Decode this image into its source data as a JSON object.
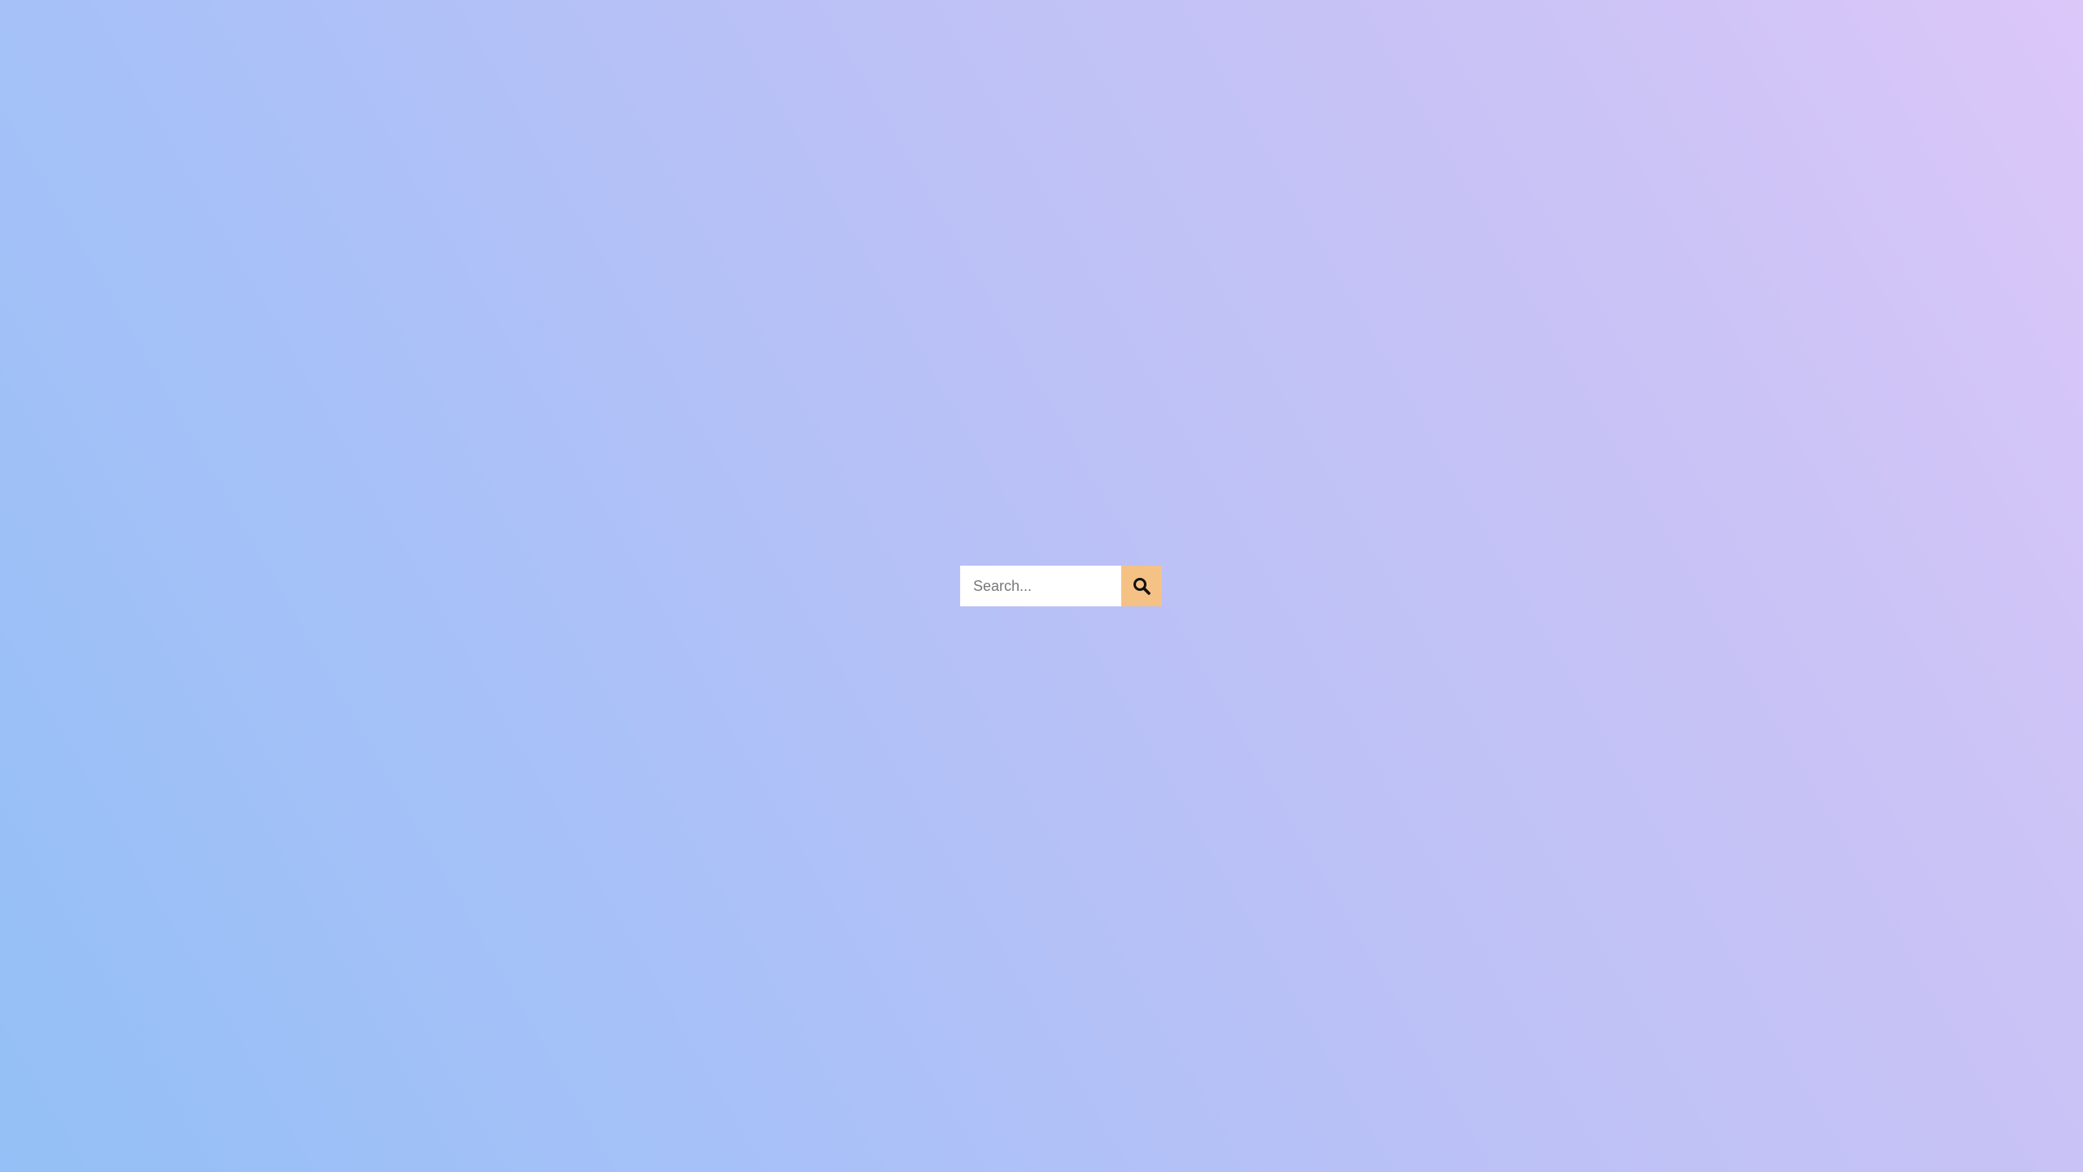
{
  "search": {
    "placeholder": "Search...",
    "value": "",
    "button_icon": "search-icon"
  },
  "colors": {
    "button_background": "#f5c185",
    "input_background": "#ffffff",
    "gradient_start": "#93c0f6",
    "gradient_end": "#dcc7f9"
  }
}
